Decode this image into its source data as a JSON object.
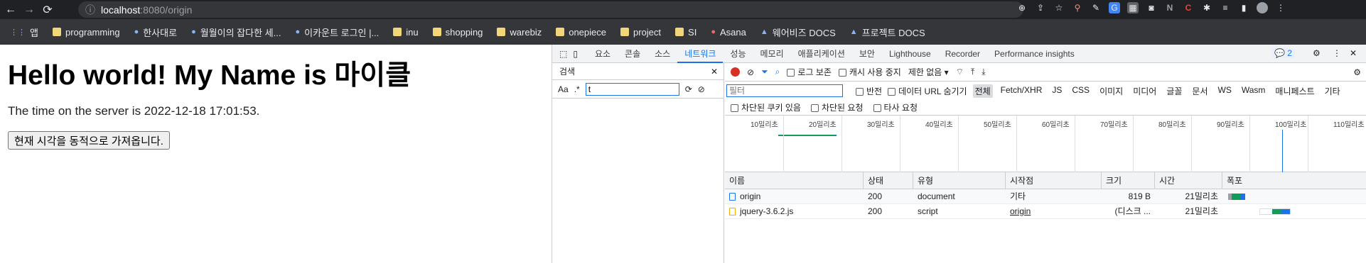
{
  "browser": {
    "url_host": "localhost",
    "url_path": ":8080/origin",
    "bookmarks": [
      {
        "label": "앱",
        "icon": "apps-grid-icon"
      },
      {
        "label": "programming",
        "icon": "folder-icon"
      },
      {
        "label": "한사대로",
        "icon": "site-icon"
      },
      {
        "label": "월월이의 잡다한 세...",
        "icon": "site-icon"
      },
      {
        "label": "이카운트 로그인 |...",
        "icon": "site-icon"
      },
      {
        "label": "inu",
        "icon": "folder-icon"
      },
      {
        "label": "shopping",
        "icon": "folder-icon"
      },
      {
        "label": "warebiz",
        "icon": "folder-icon"
      },
      {
        "label": "onepiece",
        "icon": "folder-icon"
      },
      {
        "label": "project",
        "icon": "folder-icon"
      },
      {
        "label": "SI",
        "icon": "folder-icon"
      },
      {
        "label": "Asana",
        "icon": "asana-icon"
      },
      {
        "label": "웨어비즈 DOCS",
        "icon": "drive-icon"
      },
      {
        "label": "프로젝트 DOCS",
        "icon": "drive-icon"
      }
    ]
  },
  "page": {
    "heading": "Hello world! My Name is 마이클",
    "time_text": "The time on the server is 2022-12-18 17:01:53.",
    "button_label": "현재 시각을 동적으로 가져옵니다."
  },
  "devtools": {
    "tabs": [
      "요소",
      "콘솔",
      "소스",
      "네트워크",
      "성능",
      "메모리",
      "애플리케이션",
      "보안",
      "Lighthouse",
      "Recorder",
      "Performance insights"
    ],
    "active_tab": "네트워크",
    "issues_count": "2",
    "search": {
      "title": "검색",
      "aa": "Aa",
      "regex": ".*",
      "value": "t"
    },
    "toolbar": {
      "preserve_log": "로그 보존",
      "disable_cache": "캐시 사용 중지",
      "throttle": "제한 없음"
    },
    "filter": {
      "placeholder": "필터",
      "invert": "반전",
      "hide_data_urls": "데이터 URL 숨기기",
      "types": [
        "전체",
        "Fetch/XHR",
        "JS",
        "CSS",
        "이미지",
        "미디어",
        "글꼴",
        "문서",
        "WS",
        "Wasm",
        "매니페스트",
        "기타"
      ],
      "blocked_cookies": "차단된 쿠키 있음",
      "blocked_requests": "차단된 요청",
      "third_party": "타사 요청"
    },
    "timeline_ticks": [
      "10밀리초",
      "20밀리초",
      "30밀리초",
      "40밀리초",
      "50밀리초",
      "60밀리초",
      "70밀리초",
      "80밀리초",
      "90밀리초",
      "100밀리초",
      "110밀리초"
    ],
    "columns": [
      "이름",
      "상태",
      "유형",
      "시작점",
      "크기",
      "시간",
      "폭포"
    ],
    "rows": [
      {
        "name": "origin",
        "status": "200",
        "type": "document",
        "initiator": "기타",
        "size": "819 B",
        "time": "21밀리초"
      },
      {
        "name": "jquery-3.6.2.js",
        "status": "200",
        "type": "script",
        "initiator": "origin",
        "size": "(디스크 ...",
        "time": "21밀리초"
      }
    ]
  }
}
